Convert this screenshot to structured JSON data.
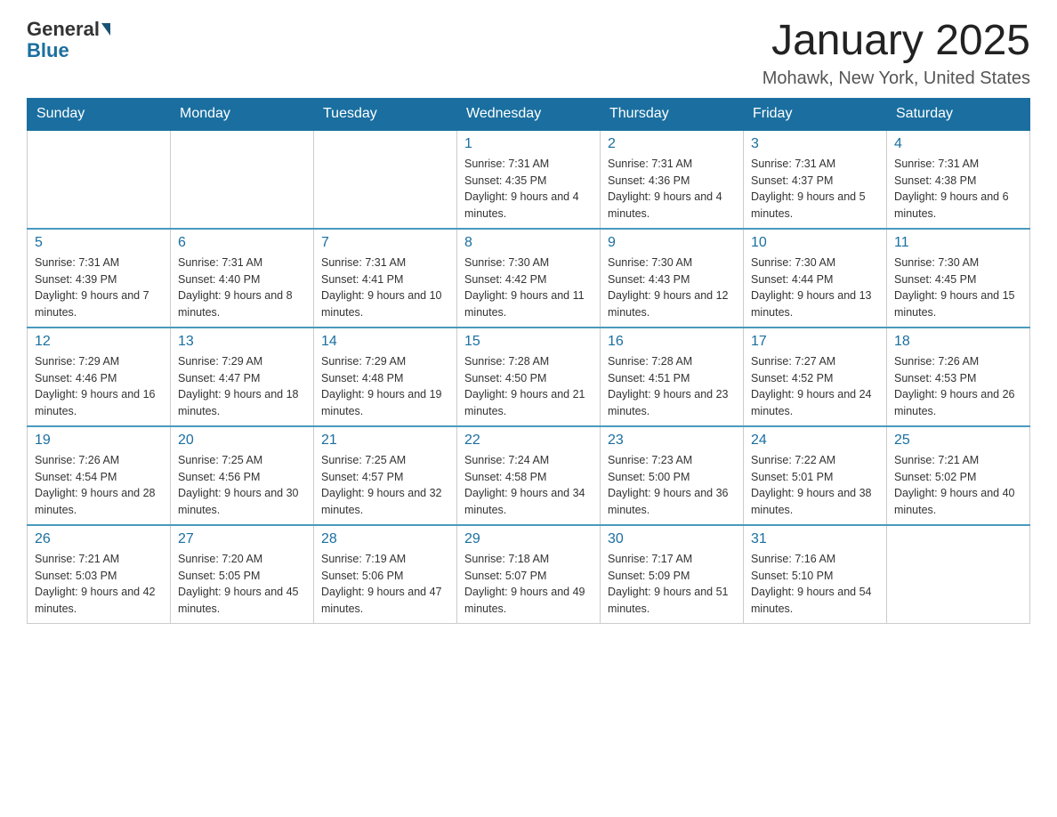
{
  "logo": {
    "general": "General",
    "blue": "Blue"
  },
  "header": {
    "month": "January 2025",
    "location": "Mohawk, New York, United States"
  },
  "days_of_week": [
    "Sunday",
    "Monday",
    "Tuesday",
    "Wednesday",
    "Thursday",
    "Friday",
    "Saturday"
  ],
  "weeks": [
    [
      {
        "day": "",
        "info": ""
      },
      {
        "day": "",
        "info": ""
      },
      {
        "day": "",
        "info": ""
      },
      {
        "day": "1",
        "info": "Sunrise: 7:31 AM\nSunset: 4:35 PM\nDaylight: 9 hours and 4 minutes."
      },
      {
        "day": "2",
        "info": "Sunrise: 7:31 AM\nSunset: 4:36 PM\nDaylight: 9 hours and 4 minutes."
      },
      {
        "day": "3",
        "info": "Sunrise: 7:31 AM\nSunset: 4:37 PM\nDaylight: 9 hours and 5 minutes."
      },
      {
        "day": "4",
        "info": "Sunrise: 7:31 AM\nSunset: 4:38 PM\nDaylight: 9 hours and 6 minutes."
      }
    ],
    [
      {
        "day": "5",
        "info": "Sunrise: 7:31 AM\nSunset: 4:39 PM\nDaylight: 9 hours and 7 minutes."
      },
      {
        "day": "6",
        "info": "Sunrise: 7:31 AM\nSunset: 4:40 PM\nDaylight: 9 hours and 8 minutes."
      },
      {
        "day": "7",
        "info": "Sunrise: 7:31 AM\nSunset: 4:41 PM\nDaylight: 9 hours and 10 minutes."
      },
      {
        "day": "8",
        "info": "Sunrise: 7:30 AM\nSunset: 4:42 PM\nDaylight: 9 hours and 11 minutes."
      },
      {
        "day": "9",
        "info": "Sunrise: 7:30 AM\nSunset: 4:43 PM\nDaylight: 9 hours and 12 minutes."
      },
      {
        "day": "10",
        "info": "Sunrise: 7:30 AM\nSunset: 4:44 PM\nDaylight: 9 hours and 13 minutes."
      },
      {
        "day": "11",
        "info": "Sunrise: 7:30 AM\nSunset: 4:45 PM\nDaylight: 9 hours and 15 minutes."
      }
    ],
    [
      {
        "day": "12",
        "info": "Sunrise: 7:29 AM\nSunset: 4:46 PM\nDaylight: 9 hours and 16 minutes."
      },
      {
        "day": "13",
        "info": "Sunrise: 7:29 AM\nSunset: 4:47 PM\nDaylight: 9 hours and 18 minutes."
      },
      {
        "day": "14",
        "info": "Sunrise: 7:29 AM\nSunset: 4:48 PM\nDaylight: 9 hours and 19 minutes."
      },
      {
        "day": "15",
        "info": "Sunrise: 7:28 AM\nSunset: 4:50 PM\nDaylight: 9 hours and 21 minutes."
      },
      {
        "day": "16",
        "info": "Sunrise: 7:28 AM\nSunset: 4:51 PM\nDaylight: 9 hours and 23 minutes."
      },
      {
        "day": "17",
        "info": "Sunrise: 7:27 AM\nSunset: 4:52 PM\nDaylight: 9 hours and 24 minutes."
      },
      {
        "day": "18",
        "info": "Sunrise: 7:26 AM\nSunset: 4:53 PM\nDaylight: 9 hours and 26 minutes."
      }
    ],
    [
      {
        "day": "19",
        "info": "Sunrise: 7:26 AM\nSunset: 4:54 PM\nDaylight: 9 hours and 28 minutes."
      },
      {
        "day": "20",
        "info": "Sunrise: 7:25 AM\nSunset: 4:56 PM\nDaylight: 9 hours and 30 minutes."
      },
      {
        "day": "21",
        "info": "Sunrise: 7:25 AM\nSunset: 4:57 PM\nDaylight: 9 hours and 32 minutes."
      },
      {
        "day": "22",
        "info": "Sunrise: 7:24 AM\nSunset: 4:58 PM\nDaylight: 9 hours and 34 minutes."
      },
      {
        "day": "23",
        "info": "Sunrise: 7:23 AM\nSunset: 5:00 PM\nDaylight: 9 hours and 36 minutes."
      },
      {
        "day": "24",
        "info": "Sunrise: 7:22 AM\nSunset: 5:01 PM\nDaylight: 9 hours and 38 minutes."
      },
      {
        "day": "25",
        "info": "Sunrise: 7:21 AM\nSunset: 5:02 PM\nDaylight: 9 hours and 40 minutes."
      }
    ],
    [
      {
        "day": "26",
        "info": "Sunrise: 7:21 AM\nSunset: 5:03 PM\nDaylight: 9 hours and 42 minutes."
      },
      {
        "day": "27",
        "info": "Sunrise: 7:20 AM\nSunset: 5:05 PM\nDaylight: 9 hours and 45 minutes."
      },
      {
        "day": "28",
        "info": "Sunrise: 7:19 AM\nSunset: 5:06 PM\nDaylight: 9 hours and 47 minutes."
      },
      {
        "day": "29",
        "info": "Sunrise: 7:18 AM\nSunset: 5:07 PM\nDaylight: 9 hours and 49 minutes."
      },
      {
        "day": "30",
        "info": "Sunrise: 7:17 AM\nSunset: 5:09 PM\nDaylight: 9 hours and 51 minutes."
      },
      {
        "day": "31",
        "info": "Sunrise: 7:16 AM\nSunset: 5:10 PM\nDaylight: 9 hours and 54 minutes."
      },
      {
        "day": "",
        "info": ""
      }
    ]
  ]
}
